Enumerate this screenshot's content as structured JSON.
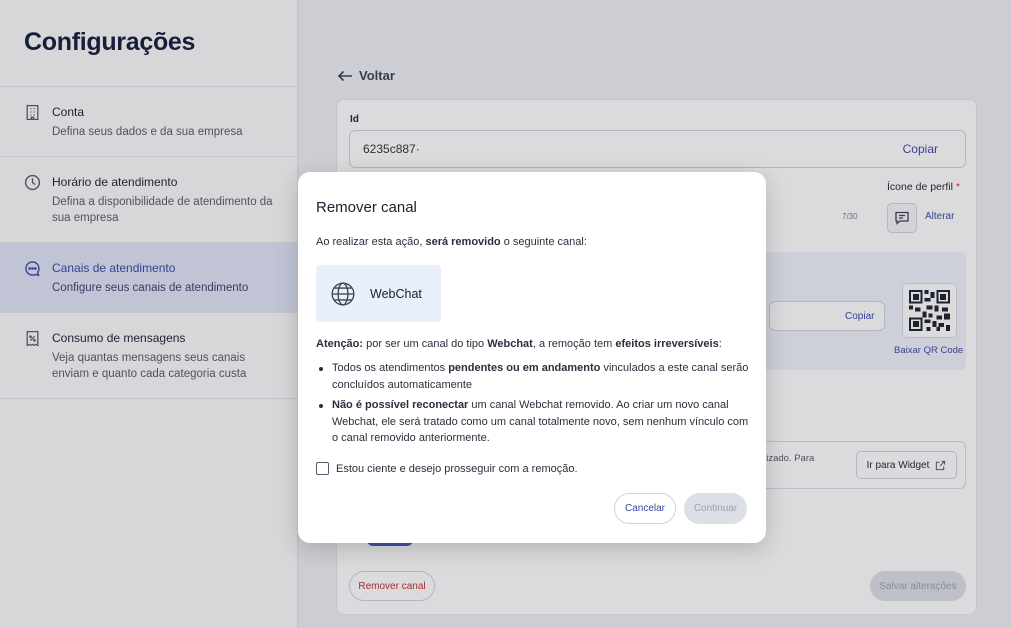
{
  "sidebar": {
    "title": "Configurações",
    "items": [
      {
        "label": "Conta",
        "desc": "Defina seus dados e da sua empresa"
      },
      {
        "label": "Horário de atendimento",
        "desc": "Defina a disponibilidade de atendimento da sua empresa"
      },
      {
        "label": "Canais de atendimento",
        "desc": "Configure seus canais de atendimento"
      },
      {
        "label": "Consumo de mensagens",
        "desc": "Veja quantas mensagens seus canais enviam e quanto cada categoria custa"
      }
    ]
  },
  "main": {
    "back_label": "Voltar",
    "id_label": "Id",
    "id_value": "6235c887·",
    "copy_label": "Copiar",
    "profile_icon_label": "Ícone de perfil",
    "required_mark": "*",
    "counter": "7/30",
    "alter_label": "Alterar",
    "copy2_label": "Copiar",
    "qr_download_label": "Baixar QR Code",
    "widget_hint": "ilizado. Para",
    "widget_button": "Ir para Widget",
    "remove_button": "Remover canal",
    "save_button": "Salvar alterações"
  },
  "modal": {
    "title": "Remover canal",
    "intro_pre": "Ao realizar esta ação, ",
    "intro_bold": "será removido",
    "intro_post": " o seguinte canal:",
    "channel_name": "WebChat",
    "warn_bold1": "Atenção:",
    "warn_mid": " por ser um canal do tipo ",
    "warn_bold2": "Webchat",
    "warn_mid2": ", a remoção tem ",
    "warn_bold3": "efeitos irreversíveis",
    "warn_end": ":",
    "bullet1_pre": "Todos os atendimentos ",
    "bullet1_bold": "pendentes ou em andamento",
    "bullet1_post": " vinculados a este canal serão concluídos automaticamente",
    "bullet2_bold": "Não é possível reconectar",
    "bullet2_post": " um canal Webchat removido. Ao criar um novo canal Webchat, ele será tratado como um canal totalmente novo, sem nenhum vínculo com o canal removido anteriormente.",
    "checkbox_label": "Estou ciente e desejo prosseguir com a remoção.",
    "cancel_label": "Cancelar",
    "continue_label": "Continuar"
  },
  "colors": {
    "accent": "#3c46a8",
    "danger": "#c62a2a",
    "active_bg": "#dfe4f6"
  }
}
